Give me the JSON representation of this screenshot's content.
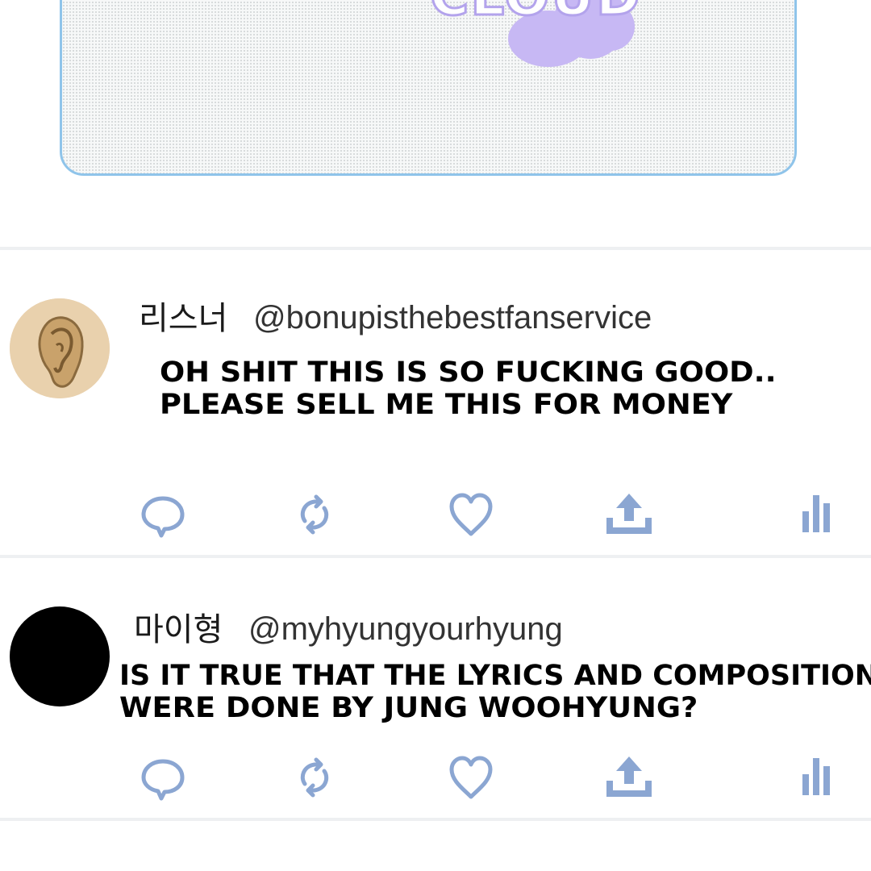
{
  "colors": {
    "card_border": "#8fc4ea",
    "cloud_accent": "#c7b8f4",
    "action_icon": "#8ba6d2",
    "divider": "#eef0f2"
  },
  "banner": {
    "logo_text": "CLOUD"
  },
  "posts": [
    {
      "display_name": "리스너",
      "handle": "@bonupisthebestfanservice",
      "text_line_1": "OH SHIT THIS IS SO FUCKING GOOD..",
      "text_line_2": "PLEASE SELL ME THIS FOR MONEY",
      "avatar": "ear-icon"
    },
    {
      "display_name": "마이형",
      "handle": "@myhyungyourhyung",
      "text_line_1": "IS IT TRUE THAT THE LYRICS AND COMPOSITION",
      "text_line_2": "WERE DONE BY JUNG WOOHYUNG?",
      "avatar": "black-circle"
    }
  ],
  "actions": [
    "reply-icon",
    "retweet-icon",
    "like-icon",
    "share-icon",
    "analytics-icon"
  ]
}
